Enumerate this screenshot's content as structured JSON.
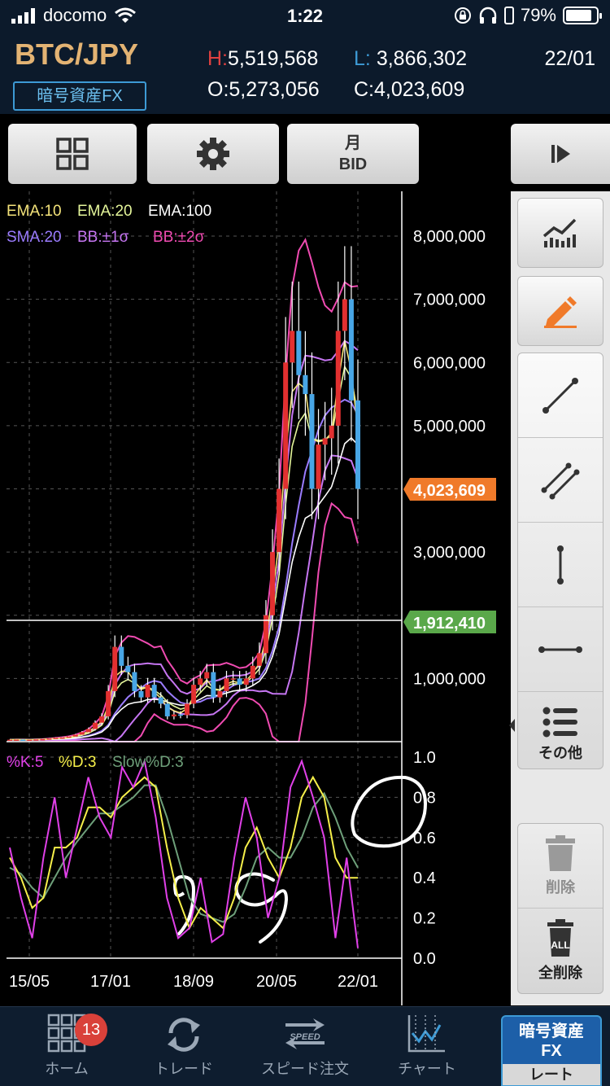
{
  "status_bar": {
    "carrier": "docomo",
    "time": "1:22",
    "battery": "79%"
  },
  "header": {
    "pair": "BTC/JPY",
    "asset_type": "暗号資産FX",
    "h_label": "H:",
    "h_value": "5,519,568",
    "l_label": "L:",
    "l_value": "3,866,302",
    "o_label": "O:",
    "o_value": "5,273,056",
    "c_label": "C:",
    "c_value": "4,023,609",
    "date": "22/01"
  },
  "toolbar": {
    "period_label": "月",
    "price_type": "BID"
  },
  "indicators": {
    "ema10": "EMA:10",
    "ema20": "EMA:20",
    "ema100": "EMA:100",
    "sma20": "SMA:20",
    "bb1": "BB:±1σ",
    "bb2": "BB:±2σ",
    "k": "%K:5",
    "d": "%D:3",
    "slow": "Slow%D:3"
  },
  "colors": {
    "ema10": "#f4e37a",
    "ema20": "#e4f59a",
    "ema100": "#ffffff",
    "sma20": "#9b7cff",
    "bb1": "#c676f2",
    "bb2": "#f04bb2",
    "k": "#e040e8",
    "d": "#f6f04a",
    "slow": "#6ea07a",
    "candle_up": "#e23030",
    "candle_down": "#48a6e6",
    "current_price_tag": "#f07a2a",
    "crosshair_tag": "#5aa84a"
  },
  "chart_data": [
    {
      "type": "candlestick",
      "y_ticks": [
        "8,000,000",
        "7,000,000",
        "6,000,000",
        "5,000,000",
        "3,000,000",
        "1,000,000"
      ],
      "ylim": [
        0,
        8000000
      ],
      "x_ticks": [
        "15/05",
        "17/01",
        "18/09",
        "20/05",
        "22/01"
      ],
      "current_price": "4,023,609",
      "crosshair_price": "1,912,410",
      "close": [
        30000,
        32000,
        28000,
        30000,
        35000,
        40000,
        50000,
        60000,
        65000,
        80000,
        110000,
        150000,
        200000,
        300000,
        400000,
        800000,
        1500000,
        1200000,
        1100000,
        800000,
        700000,
        900000,
        700000,
        600000,
        400000,
        430000,
        420000,
        600000,
        900000,
        1000000,
        1100000,
        700000,
        800000,
        1000000,
        1000000,
        900000,
        1000000,
        1200000,
        1400000,
        2000000,
        3000000,
        4000000,
        6000000,
        6500000,
        5800000,
        5500000,
        4000000,
        4700000,
        4800000,
        5000000,
        6500000,
        7000000,
        5400000,
        4000000
      ]
    },
    {
      "type": "line",
      "y_ticks": [
        "1.0",
        "0.8",
        "0.6",
        "0.4",
        "0.2",
        "0.0"
      ],
      "ylim": [
        0,
        1
      ],
      "series": [
        {
          "name": "%K:5",
          "values": [
            0.55,
            0.3,
            0.1,
            0.5,
            0.8,
            0.4,
            0.65,
            0.9,
            0.7,
            0.6,
            0.95,
            0.85,
            0.98,
            0.7,
            0.3,
            0.1,
            0.15,
            0.4,
            0.08,
            0.12,
            0.5,
            0.8,
            0.6,
            0.2,
            0.4,
            0.85,
            0.98,
            0.8,
            0.6,
            0.1,
            0.5,
            0.05
          ]
        },
        {
          "name": "%D:3",
          "values": [
            0.5,
            0.4,
            0.25,
            0.3,
            0.55,
            0.55,
            0.6,
            0.75,
            0.75,
            0.7,
            0.8,
            0.85,
            0.9,
            0.85,
            0.55,
            0.3,
            0.15,
            0.25,
            0.2,
            0.15,
            0.3,
            0.55,
            0.65,
            0.5,
            0.4,
            0.55,
            0.8,
            0.9,
            0.8,
            0.5,
            0.4,
            0.4
          ]
        },
        {
          "name": "Slow%D:3",
          "values": [
            0.45,
            0.42,
            0.35,
            0.3,
            0.4,
            0.5,
            0.58,
            0.65,
            0.72,
            0.72,
            0.76,
            0.8,
            0.86,
            0.86,
            0.7,
            0.5,
            0.3,
            0.22,
            0.2,
            0.18,
            0.22,
            0.35,
            0.5,
            0.55,
            0.5,
            0.5,
            0.6,
            0.75,
            0.82,
            0.7,
            0.55,
            0.45
          ]
        }
      ]
    }
  ],
  "right_panel": {
    "more_label": "その他",
    "delete_label": "削除",
    "delete_all_label": "全削除",
    "all_icon_text": "ALL"
  },
  "bottom_nav": {
    "home": "ホーム",
    "home_badge": "13",
    "trade": "トレード",
    "speed": "スピード注文",
    "speed_icon_text": "SPEED",
    "chart": "チャート",
    "fx_title": "暗号資産\nFX",
    "fx_sub": "レート"
  }
}
